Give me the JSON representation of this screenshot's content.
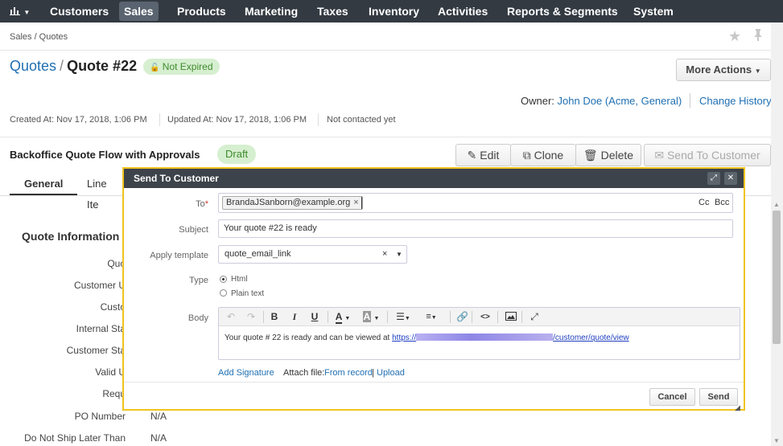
{
  "nav": {
    "dashboard_icon": "bar-chart-icon",
    "items": [
      "Customers",
      "Sales",
      "Products",
      "Marketing",
      "Taxes",
      "Inventory",
      "Activities",
      "Reports & Segments",
      "System"
    ],
    "active": "Sales"
  },
  "breadcrumb": "Sales / Quotes",
  "title": {
    "link": "Quotes",
    "separator": "/",
    "current": "Quote #22"
  },
  "status_badge": "Not Expired",
  "more_actions": "More Actions",
  "owner": {
    "label": "Owner:",
    "name": "John Doe",
    "org": "(Acme, General)"
  },
  "change_history": "Change History",
  "meta": {
    "created": "Created At: Nov 17, 2018, 1:06 PM",
    "updated": "Updated At: Nov 17, 2018, 1:06 PM",
    "contacted": "Not contacted yet"
  },
  "flow": {
    "title": "Backoffice Quote Flow with Approvals",
    "state": "Draft"
  },
  "actions": {
    "edit": "Edit",
    "clone": "Clone",
    "delete": "Delete",
    "send": "Send To Customer"
  },
  "tabs": [
    "General",
    "Line Ite"
  ],
  "section": {
    "title": "Quote Information",
    "fields": [
      {
        "label": "Quo",
        "value": ""
      },
      {
        "label": "Customer U",
        "value": ""
      },
      {
        "label": "Custo",
        "value": ""
      },
      {
        "label": "Internal Sta",
        "value": ""
      },
      {
        "label": "Customer Sta",
        "value": ""
      },
      {
        "label": "Valid U",
        "value": ""
      },
      {
        "label": "Requ",
        "value": ""
      },
      {
        "label": "PO Number",
        "value": "N/A"
      },
      {
        "label": "Do Not Ship Later Than",
        "value": "N/A"
      }
    ]
  },
  "modal": {
    "title": "Send To Customer",
    "to_label": "To",
    "required_mark": "*",
    "recipient": "BrandaJSanborn@example.org",
    "chip_remove": "×",
    "cc": "Cc",
    "bcc": "Bcc",
    "subject_label": "Subject",
    "subject": "Your quote #22  is ready",
    "template_label": "Apply template",
    "template": "quote_email_link",
    "template_clear": "×",
    "type_label": "Type",
    "type_html": "Html",
    "type_plain": "Plain text",
    "body_label": "Body",
    "body_text": "Your quote # 22  is ready and can be viewed at ",
    "body_link_start": "https://",
    "body_link_end": "/customer/quote/view",
    "add_signature": "Add Signature",
    "attach_label": "Attach file:",
    "from_record": "From record",
    "divider": "|",
    "upload": "Upload",
    "cancel": "Cancel",
    "send": "Send"
  }
}
